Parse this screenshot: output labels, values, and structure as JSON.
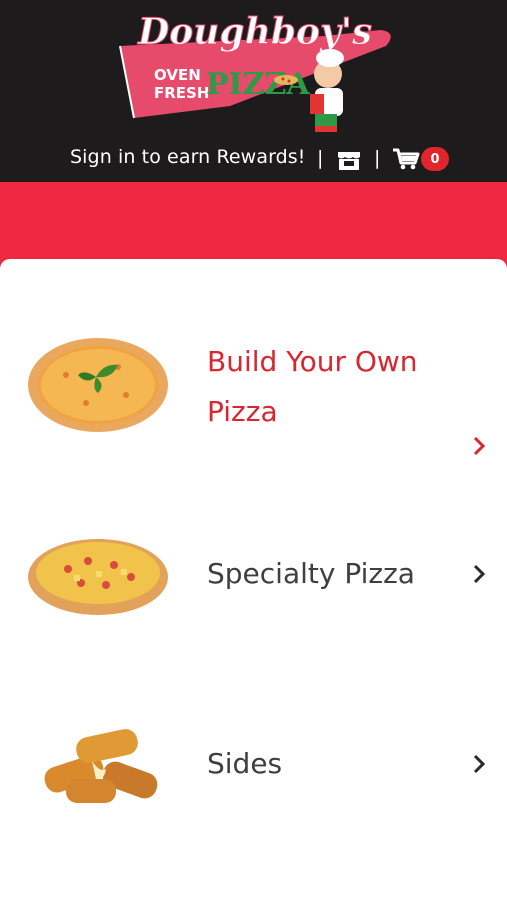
{
  "brand": {
    "name": "Doughboy's",
    "tagline_1": "OVEN",
    "tagline_2": "FRESH",
    "tagline_3": "PIZZA",
    "colors": {
      "header_bg": "#1d1b1c",
      "accent_red": "#ee2840",
      "logo_pink": "#e64b6b",
      "logo_green": "#2e9a45"
    }
  },
  "topbar": {
    "signin_label": "Sign in to earn Rewards!",
    "separator": "|",
    "store_icon": "store-icon",
    "cart_icon": "cart-icon",
    "cart_count": "0"
  },
  "menu": {
    "items": [
      {
        "label": "Build Your Own Pizza",
        "label_line1": "Build Your Own",
        "label_line2": "Pizza",
        "image": "pizza-basil-image",
        "active": true
      },
      {
        "label": "Specialty Pizza",
        "image": "hawaiian-pizza-image",
        "active": false
      },
      {
        "label": "Sides",
        "image": "mozzarella-sticks-image",
        "active": false
      }
    ],
    "chevron_icon": "chevron-right-icon"
  }
}
